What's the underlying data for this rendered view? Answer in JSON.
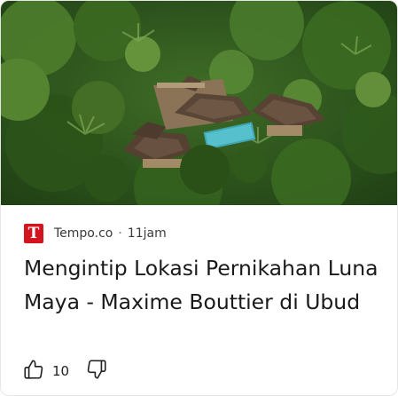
{
  "article": {
    "source": "Tempo.co",
    "source_logo_letter": "T",
    "separator": "·",
    "time_ago": "11jam",
    "headline": "Mengintip Lokasi Pernikahan Luna Maya - Maxime Bouttier di Ubud",
    "likes": "10",
    "image_alt": "Aerial view of a villa among tropical jungle"
  },
  "colors": {
    "logo_bg": "#d2141e",
    "jungle": "#2f5a1e",
    "roof": "#5a4636",
    "pool": "#3fa7b5"
  },
  "icons": {
    "like": "thumbs-up-icon",
    "dislike": "thumbs-down-icon"
  }
}
